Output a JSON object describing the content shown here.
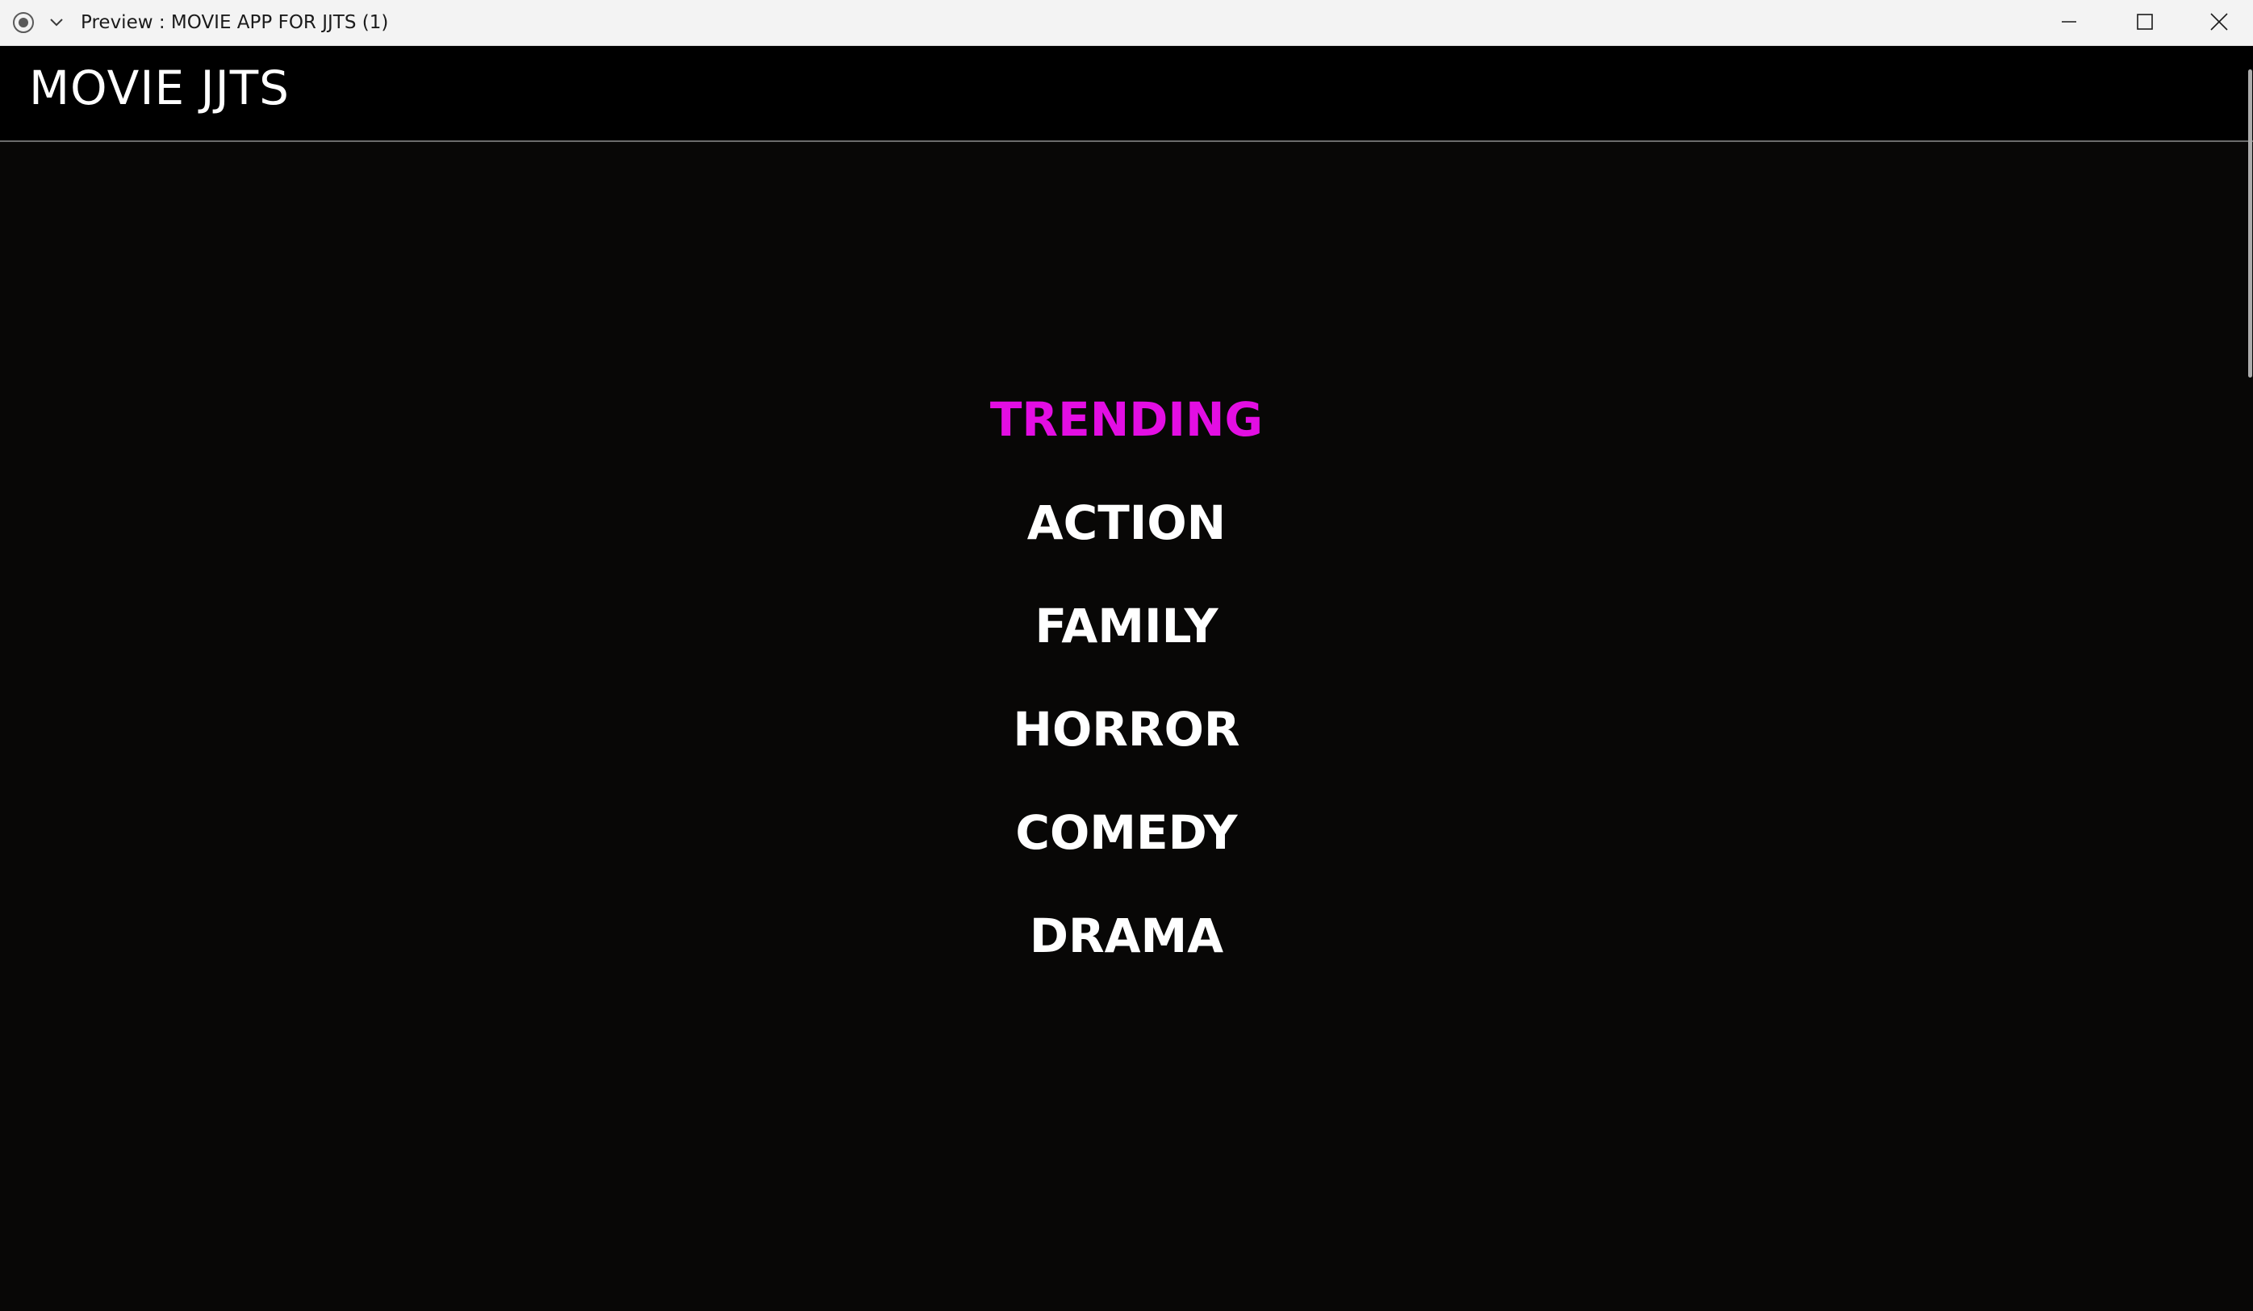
{
  "window": {
    "title": "Preview : MOVIE APP FOR JJTS (1)",
    "icons": {
      "app": "record-icon",
      "menu": "chevron-down-icon",
      "minimize": "minimize-icon",
      "maximize": "maximize-icon",
      "close": "close-icon"
    }
  },
  "header": {
    "title": "MOVIE JJTS"
  },
  "menu": {
    "items": [
      {
        "label": "TRENDING",
        "active": true
      },
      {
        "label": "ACTION",
        "active": false
      },
      {
        "label": "FAMILY",
        "active": false
      },
      {
        "label": "HORROR",
        "active": false
      },
      {
        "label": "COMEDY",
        "active": false
      },
      {
        "label": "DRAMA",
        "active": false
      }
    ]
  },
  "colors": {
    "active": "#e30ee3",
    "text": "#ffffff",
    "background": "#080706",
    "header": "#000000",
    "titlebar": "#f3f3f3"
  }
}
